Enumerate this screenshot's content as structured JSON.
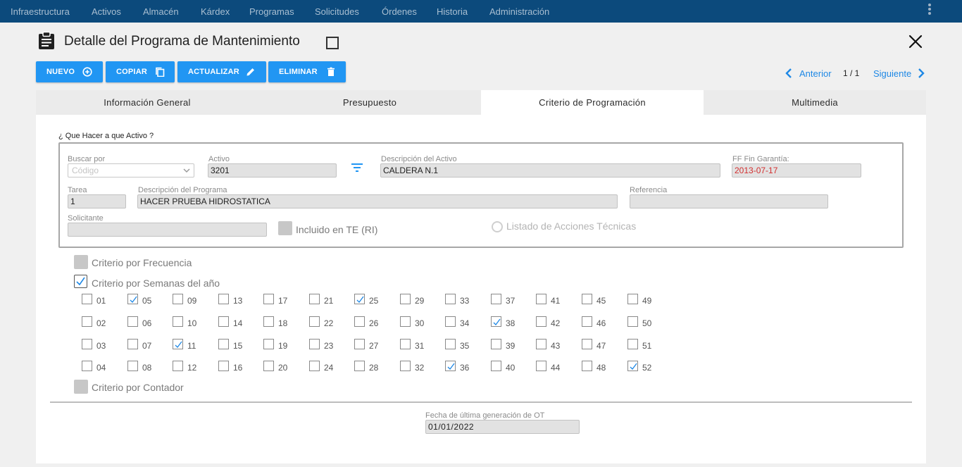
{
  "nav": {
    "items": [
      "Infraestructura",
      "Activos",
      "Almacén",
      "Kárdex",
      "Programas",
      "Solicitudes",
      "Órdenes",
      "Historia",
      "Administración"
    ],
    "menu_icon": "more-vert-icon"
  },
  "header": {
    "icon": "clipboard-icon",
    "title": "Detalle del Programa de Mantenimiento",
    "close_icon": "close-icon"
  },
  "toolbar": {
    "nuevo": "NUEVO",
    "copiar": "COPIAR",
    "actualizar": "ACTUALIZAR",
    "eliminar": "ELIMINAR"
  },
  "pager": {
    "prev": "Anterior",
    "count": "1 / 1",
    "next": "Siguiente"
  },
  "tabs": [
    {
      "label": "Información General",
      "active": false
    },
    {
      "label": "Presupuesto",
      "active": false
    },
    {
      "label": "Criterio de Programación",
      "active": true
    },
    {
      "label": "Multimedia",
      "active": false
    }
  ],
  "form": {
    "legend": "¿ Que Hacer a que Activo ?",
    "buscar_por": {
      "label": "Buscar por",
      "value": "Código"
    },
    "activo": {
      "label": "Activo",
      "value": "3201"
    },
    "descripcion_activo": {
      "label": "Descripción del Activo",
      "value": "CALDERA N.1"
    },
    "ff_fin_garantia": {
      "label": "FF Fin Garantía:",
      "value": "2013-07-17"
    },
    "tarea": {
      "label": "Tarea",
      "value": "1"
    },
    "descripcion_programa": {
      "label": "Descripción del Programa",
      "value": "HACER PRUEBA HIDROSTATICA"
    },
    "referencia": {
      "label": "Referencia",
      "value": ""
    },
    "solicitante": {
      "label": "Solicitante",
      "value": ""
    },
    "incluido_te": {
      "label": "Incluido en TE (RI)",
      "checked": false
    },
    "listado_acciones": {
      "label": "Listado de Acciones Técnicas",
      "selected": false
    }
  },
  "criterios": {
    "frecuencia": {
      "label": "Criterio por Frecuencia",
      "checked": false
    },
    "semanas": {
      "label": "Criterio por Semanas del año",
      "checked": true
    },
    "contador": {
      "label": "Criterio por Contador",
      "checked": false
    }
  },
  "weeks": [
    {
      "n": "01",
      "checked": false
    },
    {
      "n": "02",
      "checked": false
    },
    {
      "n": "03",
      "checked": false
    },
    {
      "n": "04",
      "checked": false
    },
    {
      "n": "05",
      "checked": true
    },
    {
      "n": "06",
      "checked": false
    },
    {
      "n": "07",
      "checked": false
    },
    {
      "n": "08",
      "checked": false
    },
    {
      "n": "09",
      "checked": false
    },
    {
      "n": "10",
      "checked": false
    },
    {
      "n": "11",
      "checked": true
    },
    {
      "n": "12",
      "checked": false
    },
    {
      "n": "13",
      "checked": false
    },
    {
      "n": "14",
      "checked": false
    },
    {
      "n": "15",
      "checked": false
    },
    {
      "n": "16",
      "checked": false
    },
    {
      "n": "17",
      "checked": false
    },
    {
      "n": "18",
      "checked": false
    },
    {
      "n": "19",
      "checked": false
    },
    {
      "n": "20",
      "checked": false
    },
    {
      "n": "21",
      "checked": false
    },
    {
      "n": "22",
      "checked": false
    },
    {
      "n": "23",
      "checked": false
    },
    {
      "n": "24",
      "checked": false
    },
    {
      "n": "25",
      "checked": true
    },
    {
      "n": "26",
      "checked": false
    },
    {
      "n": "27",
      "checked": false
    },
    {
      "n": "28",
      "checked": false
    },
    {
      "n": "29",
      "checked": false
    },
    {
      "n": "30",
      "checked": false
    },
    {
      "n": "31",
      "checked": false
    },
    {
      "n": "32",
      "checked": false
    },
    {
      "n": "33",
      "checked": false
    },
    {
      "n": "34",
      "checked": false
    },
    {
      "n": "35",
      "checked": false
    },
    {
      "n": "36",
      "checked": true
    },
    {
      "n": "37",
      "checked": false
    },
    {
      "n": "38",
      "checked": true
    },
    {
      "n": "39",
      "checked": false
    },
    {
      "n": "40",
      "checked": false
    },
    {
      "n": "41",
      "checked": false
    },
    {
      "n": "42",
      "checked": false
    },
    {
      "n": "43",
      "checked": false
    },
    {
      "n": "44",
      "checked": false
    },
    {
      "n": "45",
      "checked": false
    },
    {
      "n": "46",
      "checked": false
    },
    {
      "n": "47",
      "checked": false
    },
    {
      "n": "48",
      "checked": false
    },
    {
      "n": "49",
      "checked": false
    },
    {
      "n": "50",
      "checked": false
    },
    {
      "n": "51",
      "checked": false
    },
    {
      "n": "52",
      "checked": true
    }
  ],
  "footer": {
    "fecha_label": "Fecha de última generación de OT",
    "fecha_value": "01/01/2022"
  },
  "colors": {
    "nav_bg": "#0c4a7c",
    "primary": "#2196f3",
    "link": "#1e88e5",
    "warning_text": "#d32f2f"
  }
}
